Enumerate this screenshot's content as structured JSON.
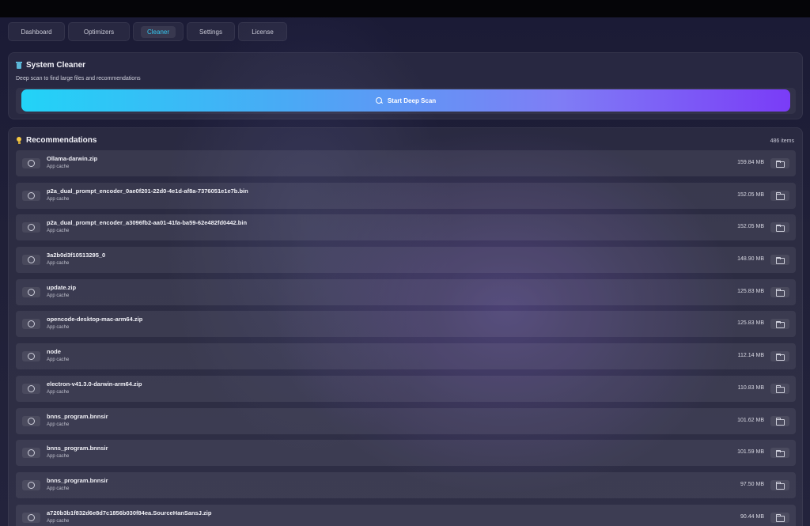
{
  "tabs": [
    {
      "label": "Dashboard"
    },
    {
      "label": "Optimizers"
    },
    {
      "label": "Cleaner"
    },
    {
      "label": "Settings"
    },
    {
      "label": "License"
    }
  ],
  "active_tab": "Cleaner",
  "cleaner": {
    "title": "System Cleaner",
    "subtitle": "Deep scan to find large files and recommendations",
    "scan_button": "Start Deep Scan"
  },
  "recommendations": {
    "title": "Recommendations",
    "count": "486 items",
    "items": [
      {
        "name": "Ollama-darwin.zip",
        "category": "App cache",
        "size": "159.84 MB"
      },
      {
        "name": "p2a_dual_prompt_encoder_0ae0f201-22d0-4e1d-af8a-7376051e1e7b.bin",
        "category": "App cache",
        "size": "152.05 MB"
      },
      {
        "name": "p2a_dual_prompt_encoder_a3096fb2-aa01-41fa-ba59-62e482fd0442.bin",
        "category": "App cache",
        "size": "152.05 MB"
      },
      {
        "name": "3a2b0d3f10513295_0",
        "category": "App cache",
        "size": "148.90 MB"
      },
      {
        "name": "update.zip",
        "category": "App cache",
        "size": "125.83 MB"
      },
      {
        "name": "opencode-desktop-mac-arm64.zip",
        "category": "App cache",
        "size": "125.83 MB"
      },
      {
        "name": "node",
        "category": "App cache",
        "size": "112.14 MB"
      },
      {
        "name": "electron-v41.3.0-darwin-arm64.zip",
        "category": "App cache",
        "size": "110.83 MB"
      },
      {
        "name": "bnns_program.bnnsir",
        "category": "App cache",
        "size": "101.62 MB"
      },
      {
        "name": "bnns_program.bnnsir",
        "category": "App cache",
        "size": "101.59 MB"
      },
      {
        "name": "bnns_program.bnnsir",
        "category": "App cache",
        "size": "97.50 MB"
      },
      {
        "name": "a720b3b1f832d6e8d7c1856b030f84ea.SourceHanSansJ.zip",
        "category": "App cache",
        "size": "90.44 MB"
      }
    ]
  }
}
